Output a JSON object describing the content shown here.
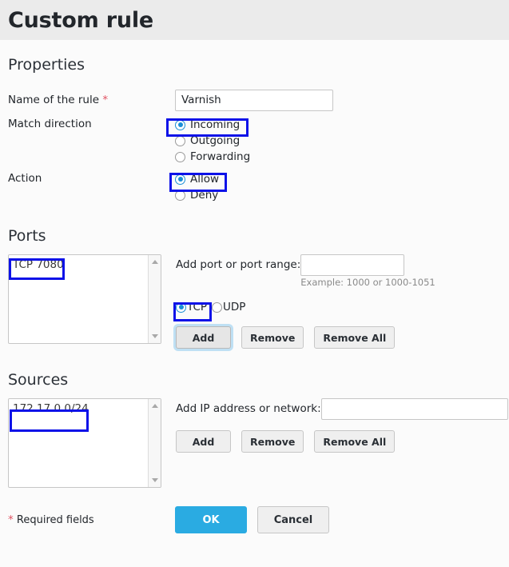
{
  "header": {
    "title": "Custom rule"
  },
  "sections": {
    "properties": "Properties",
    "ports": "Ports",
    "sources": "Sources"
  },
  "properties": {
    "name_label": "Name of the rule",
    "required_marker": "*",
    "name_value": "Varnish",
    "name_placeholder": "",
    "match_direction_label": "Match direction",
    "directions": [
      {
        "label": "Incoming",
        "selected": true
      },
      {
        "label": "Outgoing",
        "selected": false
      },
      {
        "label": "Forwarding",
        "selected": false
      }
    ],
    "action_label": "Action",
    "actions": [
      {
        "label": "Allow",
        "selected": true
      },
      {
        "label": "Deny",
        "selected": false
      }
    ]
  },
  "ports": {
    "items": [
      "TCP 7080"
    ],
    "add_label": "Add port or port range:",
    "add_value": "",
    "add_placeholder": "",
    "hint": "Example: 1000 or 1000-1051",
    "protocols": [
      {
        "label": "TCP",
        "selected": true
      },
      {
        "label": "UDP",
        "selected": false
      }
    ],
    "buttons": {
      "add": "Add",
      "remove": "Remove",
      "remove_all": "Remove All"
    }
  },
  "sources": {
    "items": [
      "172.17.0.0/24"
    ],
    "add_label": "Add IP address or network:",
    "add_value": "",
    "add_placeholder": "",
    "buttons": {
      "add": "Add",
      "remove": "Remove",
      "remove_all": "Remove All"
    }
  },
  "footer": {
    "required_marker": "*",
    "required_text": "Required fields",
    "ok": "OK",
    "cancel": "Cancel"
  },
  "colors": {
    "header_bg": "#ebebeb",
    "page_bg": "#fbfbfb",
    "accent": "#2aabe2",
    "radio_selected": "#1a8fd6",
    "required_star": "#e05262",
    "annotation": "#0d12e8"
  }
}
